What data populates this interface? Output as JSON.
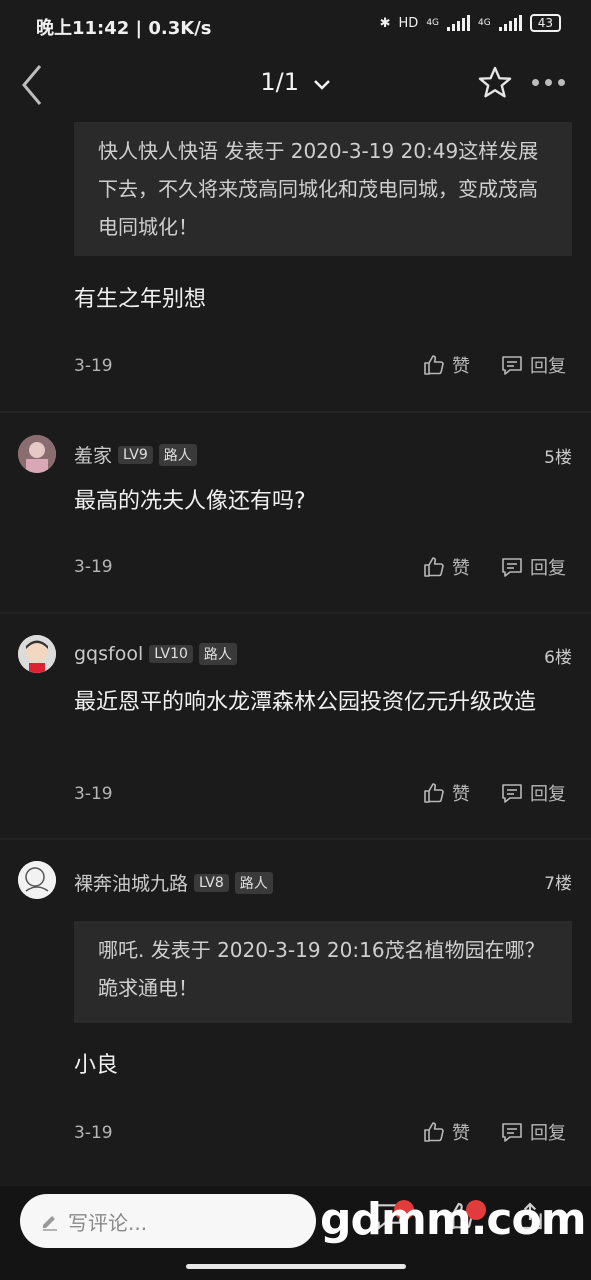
{
  "status": {
    "time": "晚上11:42 | 0.3K/s",
    "battery": "43",
    "net1": "4G",
    "net2": "4G"
  },
  "nav": {
    "title": "1/1"
  },
  "posts": [
    {
      "id": "p4",
      "quote": "快人快人快语 发表于 2020-3-19 20:49这样发展下去，不久将来茂高同城化和茂电同城，变成茂高电同城化！",
      "content": "有生之年别想",
      "date": "3-19",
      "like": "赞",
      "reply": "回复"
    },
    {
      "id": "p5",
      "user": "羞家",
      "level": "LV9",
      "role": "路人",
      "floor": "5楼",
      "content": "最高的冼夫人像还有吗?",
      "date": "3-19",
      "like": "赞",
      "reply": "回复"
    },
    {
      "id": "p6",
      "user": "gqsfool",
      "level": "LV10",
      "role": "路人",
      "floor": "6楼",
      "content": "最近恩平的响水龙潭森林公园投资亿元升级改造",
      "date": "3-19",
      "like": "赞",
      "reply": "回复"
    },
    {
      "id": "p7",
      "user": "裸奔油城九路",
      "level": "LV8",
      "role": "路人",
      "floor": "7楼",
      "quote": "哪吒. 发表于 2020-3-19 20:16茂名植物园在哪？跪求通电！",
      "content": "小良",
      "date": "3-19",
      "like": "赞",
      "reply": "回复"
    }
  ],
  "bottom": {
    "placeholder": "写评论...",
    "watermark": "gdmm.com"
  }
}
